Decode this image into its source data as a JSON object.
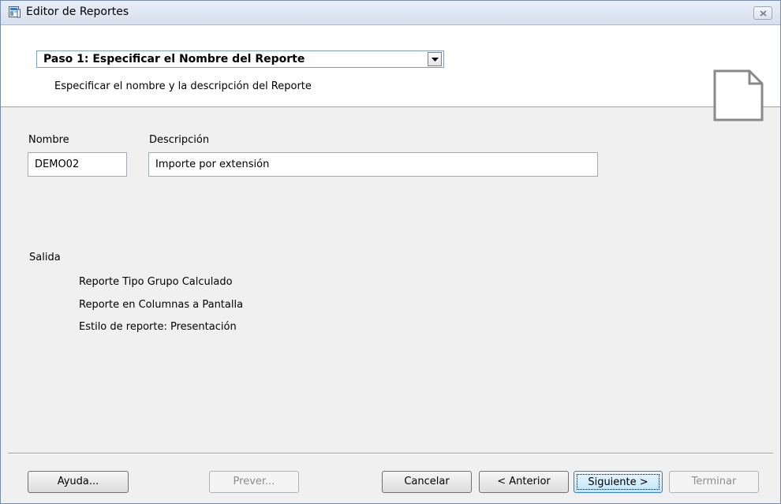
{
  "window": {
    "title": "Editor de Reportes"
  },
  "header": {
    "step_selected": "Paso 1: Especificar el Nombre del Reporte",
    "step_description": "Especificar el nombre y la descripción del Reporte"
  },
  "form": {
    "name_label": "Nombre",
    "name_value": "DEMO02",
    "description_label": "Descripción",
    "description_value": "Importe por extensión"
  },
  "output": {
    "label": "Salida",
    "lines": [
      "Reporte Tipo Grupo Calculado",
      "Reporte en Columnas a Pantalla",
      "Estilo de reporte: Presentación"
    ]
  },
  "buttons": {
    "help": "Ayuda...",
    "preview": "Prever...",
    "cancel": "Cancelar",
    "previous": "< Anterior",
    "next": "Siguiente >",
    "finish": "Terminar"
  },
  "icons": {
    "app": "report-editor-icon",
    "close": "close-icon",
    "dropdown": "chevron-down-icon",
    "document": "blank-document-icon"
  }
}
